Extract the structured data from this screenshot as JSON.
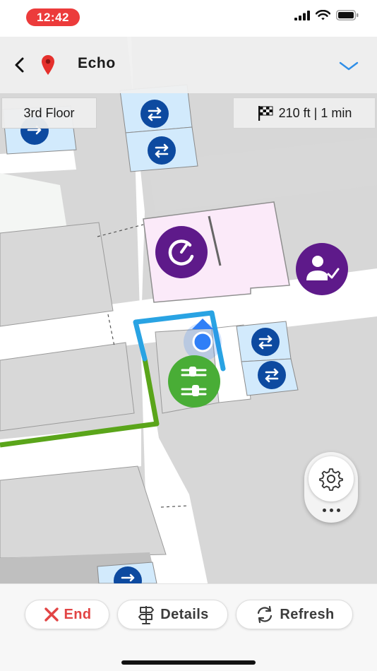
{
  "status_bar": {
    "time": "12:42"
  },
  "header": {
    "venue_name": "Echo"
  },
  "map": {
    "floor": "3rd Floor",
    "route_summary": "210 ft | 1 min"
  },
  "icons": {
    "back": "chevron-left-icon",
    "venue_pin": "map-pin-icon",
    "expand": "chevron-down-icon",
    "destination": "checkered-flag-icon",
    "elevator": "elevator-icon",
    "room_g": "g-circle-icon",
    "reception": "person-check-icon",
    "charging": "ev-charging-icon",
    "settings": "gear-icon",
    "more": "more-dots-icon"
  },
  "actions": {
    "end_label": "End",
    "details_label": "Details",
    "refresh_label": "Refresh"
  },
  "colors": {
    "route_traveled": "#5aa51a",
    "route_ahead": "#29a3e3",
    "user_location": "#2f7ff7",
    "elevator_badge": "#0d4aa0",
    "elevator_room": "#d2eafc",
    "poi_purple": "#5e1a8a",
    "poi_green": "#49ad36",
    "end_button_text": "#e24444",
    "time_pill": "#ec3b3b"
  }
}
